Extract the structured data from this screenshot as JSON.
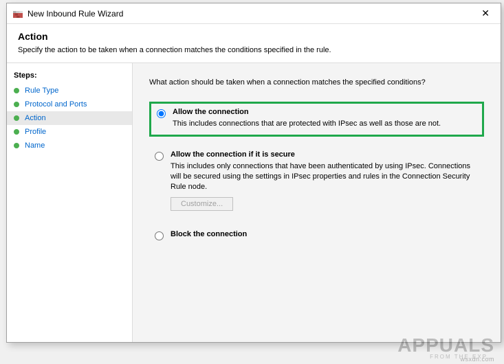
{
  "window": {
    "title": "New Inbound Rule Wizard",
    "close": "✕"
  },
  "header": {
    "title": "Action",
    "subtitle": "Specify the action to be taken when a connection matches the conditions specified in the rule."
  },
  "sidebar": {
    "steps_header": "Steps:",
    "items": [
      {
        "label": "Rule Type"
      },
      {
        "label": "Protocol and Ports"
      },
      {
        "label": "Action"
      },
      {
        "label": "Profile"
      },
      {
        "label": "Name"
      }
    ]
  },
  "main": {
    "prompt": "What action should be taken when a connection matches the specified conditions?",
    "options": [
      {
        "title": "Allow the connection",
        "desc": "This includes connections that are protected with IPsec as well as those are not."
      },
      {
        "title": "Allow the connection if it is secure",
        "desc": "This includes only connections that have been authenticated by using IPsec. Connections will be secured using the settings in IPsec properties and rules in the Connection Security Rule node.",
        "customize": "Customize..."
      },
      {
        "title": "Block the connection"
      }
    ]
  },
  "watermark": {
    "brand": "APPUALS",
    "tag": "FROM THE EXP…",
    "src": "wsxdn.com"
  }
}
